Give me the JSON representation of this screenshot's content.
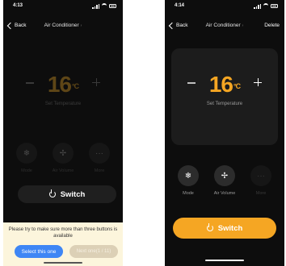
{
  "left": {
    "time": "4:13",
    "nav": {
      "back": "Back",
      "title": "Air Conditioner",
      "title_caret": "›"
    },
    "temperature": {
      "value": "16",
      "unit": "°C",
      "label": "Set Temperature"
    },
    "modes": [
      {
        "label": "Mode",
        "icon": "snowflake-icon",
        "glyph": "❄"
      },
      {
        "label": "Air Volume",
        "icon": "fan-icon",
        "glyph": "✢"
      },
      {
        "label": "More",
        "icon": "more-icon",
        "glyph": "···"
      }
    ],
    "switch_label": "Switch",
    "prompt": {
      "message": "Please try to make sure more than three buttons is available",
      "select_label": "Select this one",
      "next_label": "Next one(1 / 11)"
    }
  },
  "right": {
    "time": "4:14",
    "nav": {
      "back": "Back",
      "title": "Air Conditioner",
      "title_caret": "›",
      "delete": "Delete"
    },
    "temperature": {
      "value": "16",
      "unit": "°C",
      "label": "Set Temperature"
    },
    "modes": [
      {
        "label": "Mode",
        "icon": "snowflake-icon",
        "glyph": "❄"
      },
      {
        "label": "Air Volume",
        "icon": "fan-icon",
        "glyph": "✢"
      },
      {
        "label": "More",
        "icon": "more-icon",
        "glyph": "···"
      }
    ],
    "switch_label": "Switch"
  },
  "colors": {
    "accent": "#f5a623",
    "background": "#0d0d0d",
    "select_button": "#3e86f5",
    "prompt_panel": "#fcf5dc"
  }
}
